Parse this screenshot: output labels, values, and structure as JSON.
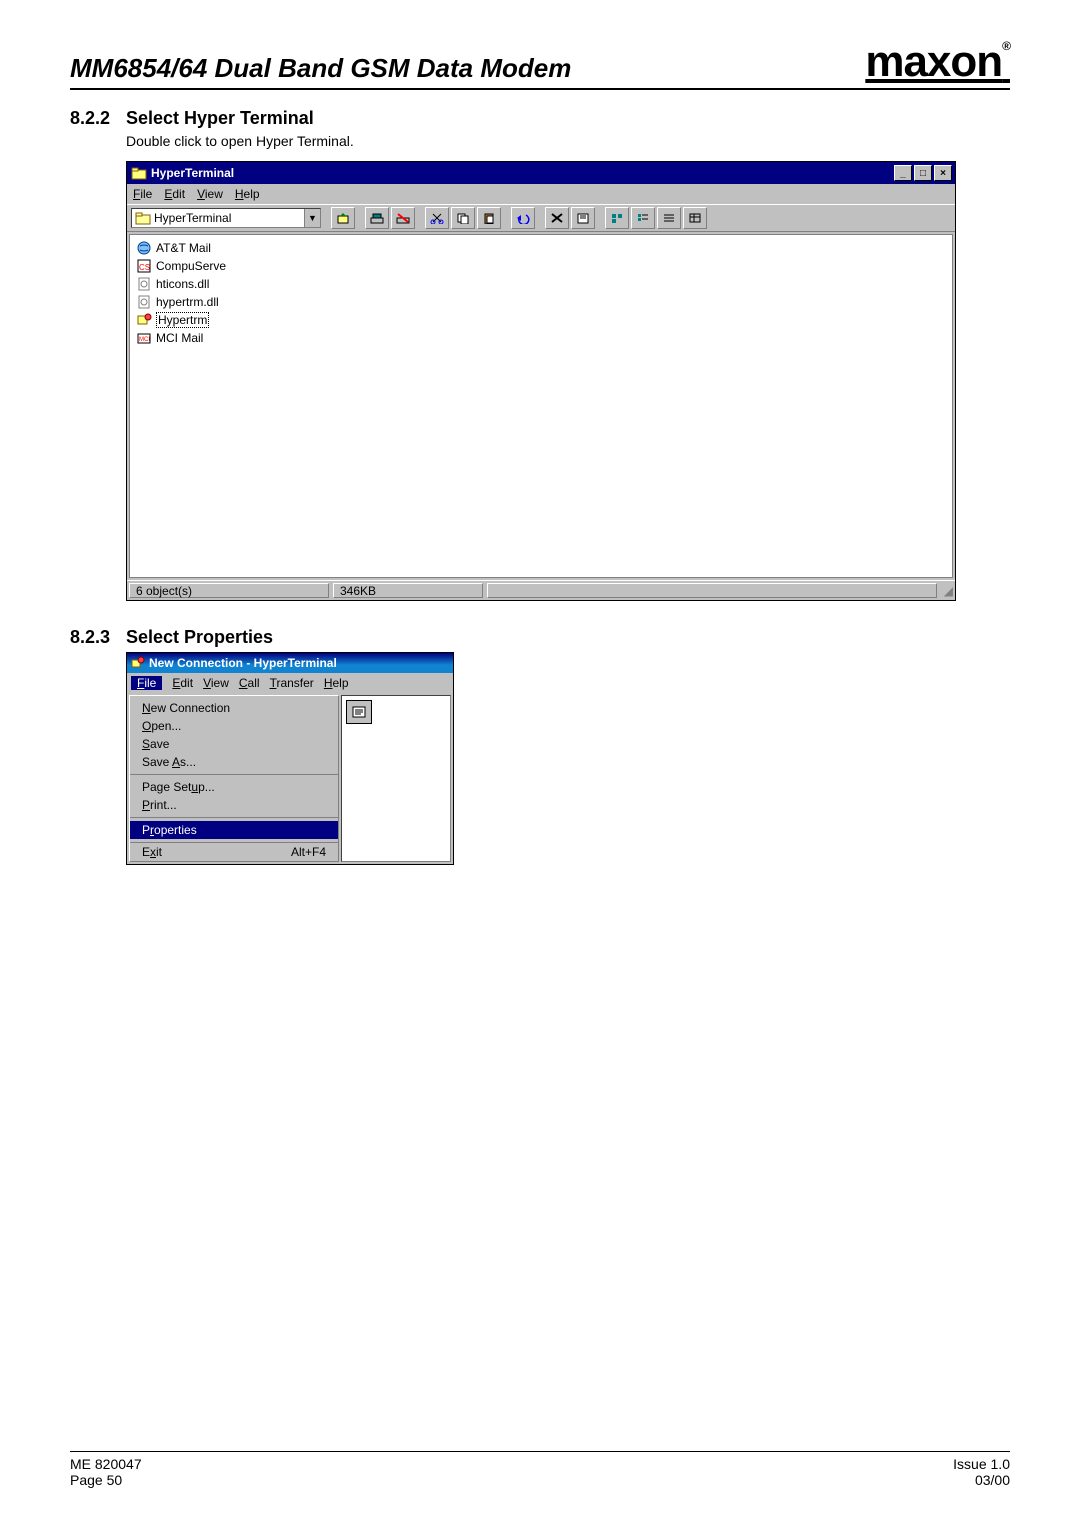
{
  "doc": {
    "title": "MM6854/64 Dual Band GSM Data Modem",
    "brand": "maxon",
    "brand_r": "®"
  },
  "section1": {
    "num": "8.2.2",
    "title": "Select Hyper Terminal",
    "body": "Double click to open Hyper Terminal."
  },
  "section2": {
    "num": "8.2.3",
    "title": "Select Properties"
  },
  "win1": {
    "title": "HyperTerminal",
    "menus": {
      "file": "File",
      "edit": "Edit",
      "view": "View",
      "help": "Help"
    },
    "address_label": "HyperTerminal",
    "files": [
      {
        "name": "AT&T Mail"
      },
      {
        "name": "CompuServe"
      },
      {
        "name": "hticons.dll"
      },
      {
        "name": "hypertrm.dll"
      },
      {
        "name": "Hypertrm"
      },
      {
        "name": "MCI Mail"
      }
    ],
    "status_objects": "6 object(s)",
    "status_size": "346KB"
  },
  "win2": {
    "title": "New Connection - HyperTerminal",
    "menus": {
      "file": "File",
      "edit": "Edit",
      "view": "View",
      "call": "Call",
      "transfer": "Transfer",
      "help": "Help"
    },
    "filemenu": {
      "new": "New Connection",
      "open": "Open...",
      "save": "Save",
      "saveas": "Save As...",
      "pagesetup": "Page Setup...",
      "print": "Print...",
      "properties": "Properties",
      "exit": "Exit",
      "exit_accel": "Alt+F4"
    }
  },
  "footer": {
    "left1": "ME 820047",
    "left2": "Page 50",
    "right1": "Issue 1.0",
    "right2": "03/00"
  }
}
